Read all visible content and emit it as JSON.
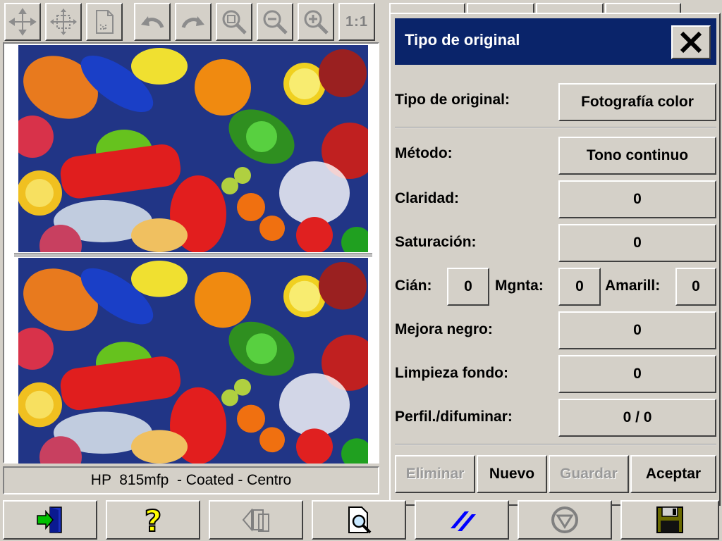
{
  "toolbar": {
    "top": [
      {
        "name": "move-icon"
      },
      {
        "name": "fit-page-icon"
      },
      {
        "name": "crop-document-icon"
      },
      {
        "name": "undo-icon"
      },
      {
        "name": "redo-icon"
      },
      {
        "name": "zoom-area-icon"
      },
      {
        "name": "zoom-out-icon"
      },
      {
        "name": "zoom-in-icon"
      },
      {
        "name": "actual-size-icon",
        "label": "1:1"
      }
    ],
    "bottom": [
      {
        "name": "exit-icon",
        "color": "#00c000"
      },
      {
        "name": "help-icon",
        "color": "#ffff00"
      },
      {
        "name": "rotate-page-icon",
        "color": "#808080"
      },
      {
        "name": "preview-search-icon",
        "color": "#0000c0"
      },
      {
        "name": "media-icon",
        "color": "#0000ff"
      },
      {
        "name": "stop-icon",
        "color": "#808080"
      },
      {
        "name": "save-icon",
        "color": "#606000"
      }
    ]
  },
  "status": {
    "text": "HP  815mfp  - Coated - Centro"
  },
  "dialog": {
    "title": "Tipo de original",
    "rows": {
      "tipo": {
        "label": "Tipo de original:",
        "value": "Fotografía color"
      },
      "metodo": {
        "label": "Método:",
        "value": "Tono continuo"
      },
      "claridad": {
        "label": "Claridad:",
        "value": "0"
      },
      "saturacion": {
        "label": "Saturación:",
        "value": "0"
      },
      "cian": {
        "label": "Cián:",
        "value": "0"
      },
      "magenta": {
        "label": "Mgnta:",
        "value": "0"
      },
      "amarillo": {
        "label": "Amarill:",
        "value": "0"
      },
      "mejora_negro": {
        "label": "Mejora negro:",
        "value": "0"
      },
      "limpieza_fondo": {
        "label": "Limpieza fondo:",
        "value": "0"
      },
      "perfil": {
        "label": "Perfil./difuminar:",
        "value": "0 / 0"
      }
    },
    "buttons": {
      "eliminar": "Eliminar",
      "nuevo": "Nuevo",
      "guardar": "Guardar",
      "aceptar": "Aceptar"
    }
  },
  "colors": {
    "title_bar": "#0a246a",
    "chrome": "#d4d0c8",
    "disabled_text": "#9a9a9a"
  }
}
